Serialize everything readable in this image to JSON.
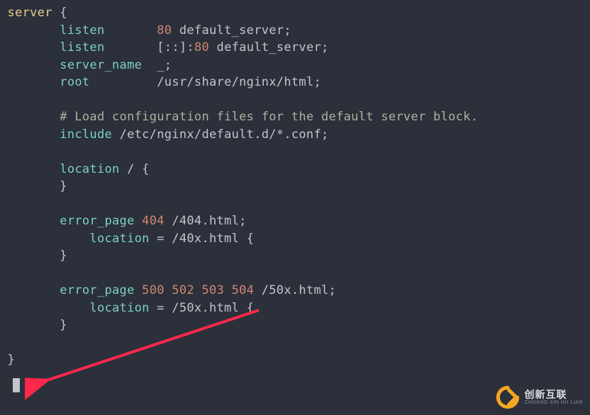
{
  "code": {
    "l01_kw": "server",
    "l01_rest": " {",
    "indent1": "    ",
    "indent2": "        ",
    "l02_kw": "listen",
    "l02_pad": "       ",
    "l02_num": "80",
    "l02_rest": " default_server;",
    "l03_kw": "listen",
    "l03_pad": "       ",
    "l03_mid": "[::]:",
    "l03_num": "80",
    "l03_rest": " default_server;",
    "l04_kw": "server_name",
    "l04_pad": "  ",
    "l04_rest": "_;",
    "l05_kw": "root",
    "l05_pad": "         ",
    "l05_rest": "/usr/share/nginx/html;",
    "l07_comment": "# Load configuration files for the default server block.",
    "l08_kw": "include",
    "l08_rest": " /etc/nginx/default.d/*.conf;",
    "l10_kw": "location",
    "l10_rest": " / {",
    "l11": "}",
    "l13_kw": "error_page",
    "l13_n1": " 404",
    "l13_rest": " /404.html;",
    "l14_kw": "location",
    "l14_rest": " = /40x.html {",
    "l15": "}",
    "l17_kw": "error_page",
    "l17_n1": " 500",
    "l17_n2": " 502",
    "l17_n3": " 503",
    "l17_n4": " 504",
    "l17_rest": " /50x.html;",
    "l18_kw": "location",
    "l18_rest": " = /50x.html {",
    "l19": "}",
    "l21": "}"
  },
  "watermark": {
    "cn": "创新互联",
    "en": "CHUANG XIN HU LIAN"
  }
}
